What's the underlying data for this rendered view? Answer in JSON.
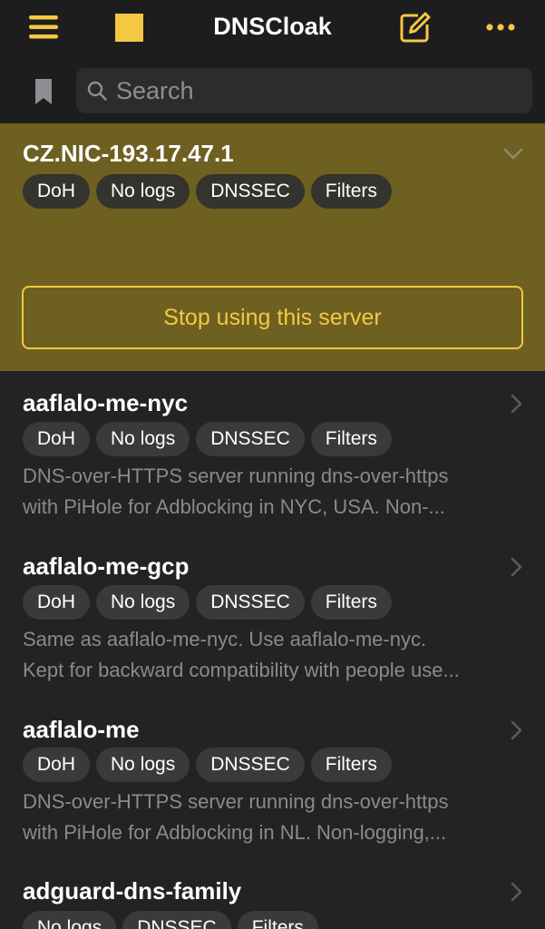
{
  "nav": {
    "title": "DNSCloak",
    "icons": [
      "menu-icon",
      "stop-icon",
      "compose-icon",
      "more-icon"
    ]
  },
  "search": {
    "placeholder": "Search",
    "value": ""
  },
  "colors": {
    "accent": "#f5c842",
    "selected_bg": "#6e6021",
    "background": "#232325",
    "tag_bg": "#3a3a3c",
    "description": "#8a8a8e"
  },
  "selected_server": {
    "name": "CZ.NIC-193.17.47.1",
    "tags": [
      "DoH",
      "No logs",
      "DNSSEC",
      "Filters"
    ],
    "action_label": "Stop using this server"
  },
  "servers": [
    {
      "name": "aaflalo-me-nyc",
      "tags": [
        "DoH",
        "No logs",
        "DNSSEC",
        "Filters"
      ],
      "description": [
        "DNS-over-HTTPS server running dns-over-https",
        "with PiHole for Adblocking in NYC, USA. Non-..."
      ]
    },
    {
      "name": "aaflalo-me-gcp",
      "tags": [
        "DoH",
        "No logs",
        "DNSSEC",
        "Filters"
      ],
      "description": [
        "Same as aaflalo-me-nyc. Use aaflalo-me-nyc.",
        "Kept for backward compatibility with people use..."
      ]
    },
    {
      "name": "aaflalo-me",
      "tags": [
        "DoH",
        "No logs",
        "DNSSEC",
        "Filters"
      ],
      "description": [
        "DNS-over-HTTPS server running dns-over-https",
        "with PiHole for Adblocking in NL. Non-logging,..."
      ]
    },
    {
      "name": "adguard-dns-family",
      "tags": [
        "No logs",
        "DNSSEC",
        "Filters"
      ],
      "description": []
    }
  ]
}
